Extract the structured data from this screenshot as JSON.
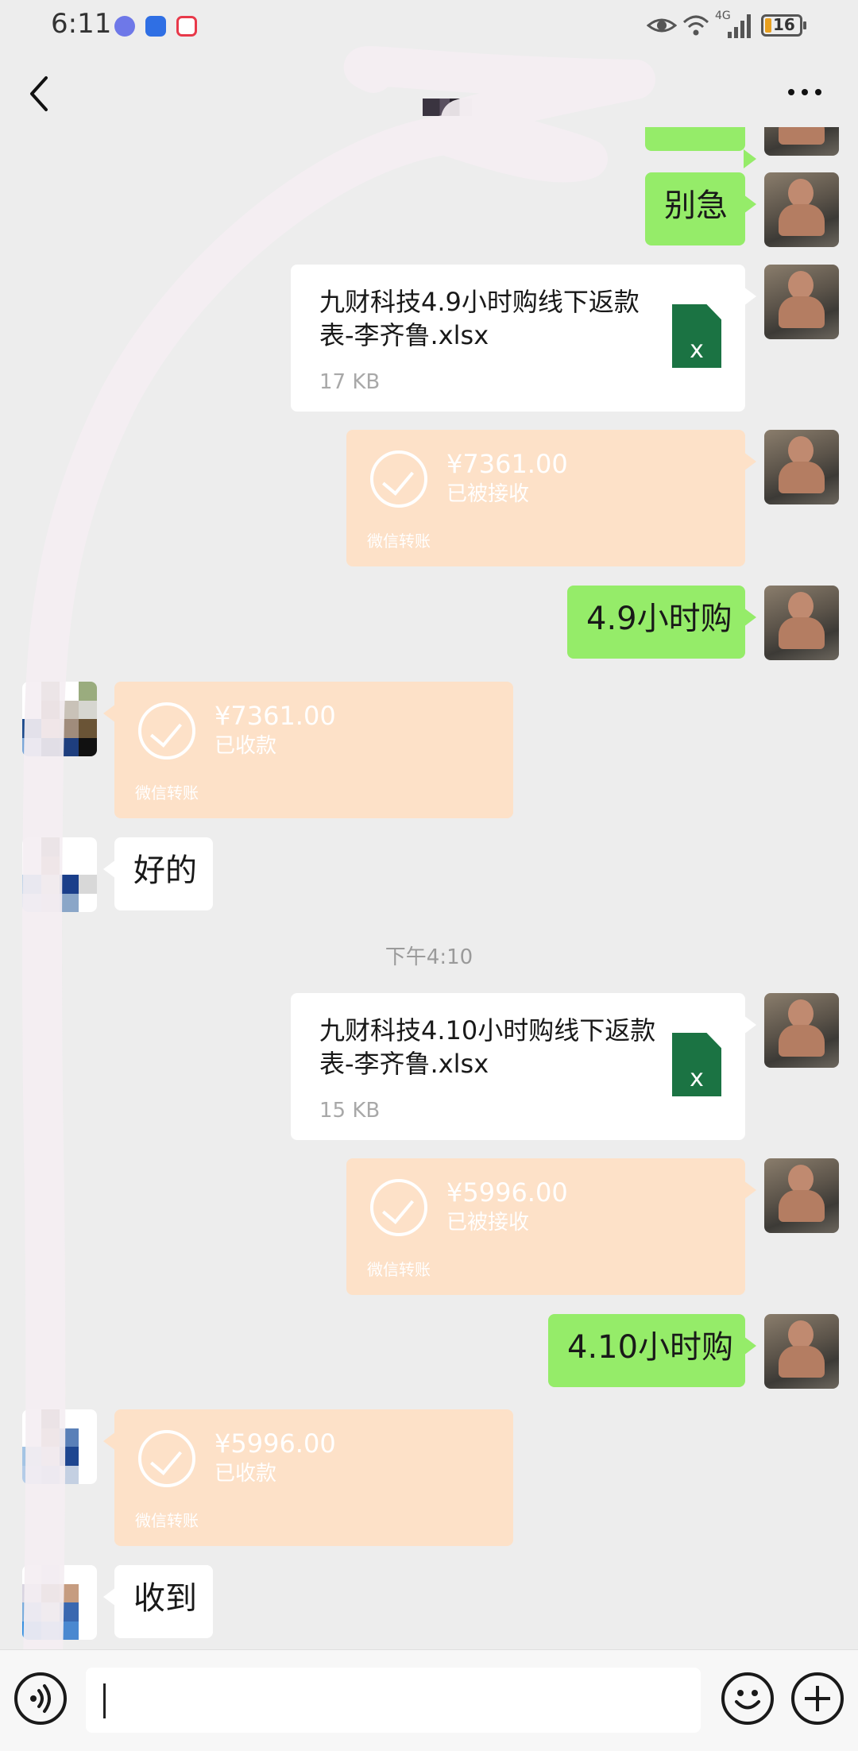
{
  "status_bar": {
    "time": "6:11",
    "network": "4G",
    "battery": "16",
    "app_icons": [
      "music-app-icon",
      "browser-app-icon",
      "red-app-icon"
    ]
  },
  "header": {
    "back_icon": "chevron-left-icon",
    "title": "",
    "more_icon": "more-dots-icon"
  },
  "messages": [
    {
      "kind": "text",
      "side": "right",
      "text": "别急"
    },
    {
      "kind": "file",
      "side": "right",
      "name": "九财科技4.9小时购线下返款表-李齐鲁.xlsx",
      "size": "17 KB",
      "file_icon": "excel-file-icon",
      "badge": "x"
    },
    {
      "kind": "transfer",
      "side": "right",
      "amount": "¥7361.00",
      "status": "已被接收",
      "footer": "微信转账"
    },
    {
      "kind": "text",
      "side": "right",
      "text": "4.9小时购"
    },
    {
      "kind": "transfer",
      "side": "left",
      "amount": "¥7361.00",
      "status": "已收款",
      "footer": "微信转账"
    },
    {
      "kind": "text",
      "side": "left",
      "text": "好的"
    },
    {
      "kind": "timestamp",
      "text": "下午4:10"
    },
    {
      "kind": "file",
      "side": "right",
      "name": "九财科技4.10小时购线下返款表-李齐鲁.xlsx",
      "size": "15 KB",
      "file_icon": "excel-file-icon",
      "badge": "x"
    },
    {
      "kind": "transfer",
      "side": "right",
      "amount": "¥5996.00",
      "status": "已被接收",
      "footer": "微信转账"
    },
    {
      "kind": "text",
      "side": "right",
      "text": "4.10小时购"
    },
    {
      "kind": "transfer",
      "side": "left",
      "amount": "¥5996.00",
      "status": "已收款",
      "footer": "微信转账"
    },
    {
      "kind": "text",
      "side": "left",
      "text": "收到"
    }
  ],
  "input_bar": {
    "voice_icon": "voice-icon",
    "input_value": "",
    "emoji_icon": "emoji-icon",
    "plus_icon": "plus-icon"
  },
  "colors": {
    "chat_background": "#ededed",
    "my_bubble": "#95ec69",
    "other_bubble": "#ffffff",
    "transfer_bubble": "#fde1c8",
    "excel_green": "#1b7343",
    "scribble": "#f4eef2"
  }
}
